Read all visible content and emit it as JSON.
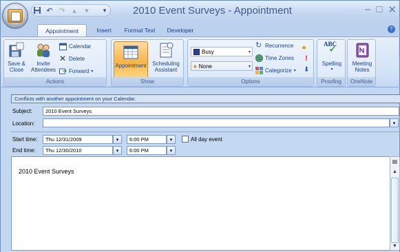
{
  "window": {
    "title": "2010 Event Surveys - Appointment",
    "controls": [
      "minimize",
      "restore",
      "close"
    ]
  },
  "quick_access": [
    "save-icon",
    "undo-icon",
    "redo-icon",
    "previous-item-icon",
    "next-item-icon",
    "customize-icon"
  ],
  "tabs": [
    {
      "label": "Appointment",
      "active": true
    },
    {
      "label": "Insert"
    },
    {
      "label": "Format Text"
    },
    {
      "label": "Developer"
    }
  ],
  "ribbon": {
    "actions": {
      "label": "Actions",
      "save_close_1": "Save &",
      "save_close_2": "Close",
      "invite_1": "Invite",
      "invite_2": "Attendees",
      "calendar": "Calendar",
      "delete": "Delete",
      "forward": "Forward"
    },
    "show": {
      "label": "Show",
      "appointment": "Appointment",
      "scheduling_1": "Scheduling",
      "scheduling_2": "Assistant"
    },
    "options": {
      "label": "Options",
      "show_as": "Busy",
      "reminder": "None",
      "recurrence": "Recurrence",
      "time_zones": "Time Zones",
      "categorize": "Categorize"
    },
    "proofing": {
      "label": "Proofing",
      "spelling": "Spelling",
      "spelling_icon_text": "ABC"
    },
    "onenote": {
      "label": "OneNote",
      "meeting_1": "Meeting",
      "meeting_2": "Notes"
    }
  },
  "form": {
    "info_bar": "Conflicts with another appointment on your Calendar.",
    "subject_label": "Subject:",
    "subject_value": "2010 Event Surveys",
    "location_label": "Location:",
    "location_value": "",
    "start_label": "Start time:",
    "start_date": "Thu 12/31/2009",
    "start_time": "6:00 PM",
    "end_label": "End time:",
    "end_date": "Thu 12/30/2010",
    "end_time": "6:00 PM",
    "all_day_label": "All day event",
    "all_day_checked": false,
    "body_text": "2010 Event Surveys"
  },
  "colors": {
    "ribbon_bg": "#d4e3f7",
    "selected_button": "#f9b548",
    "text_blue": "#15428b"
  }
}
